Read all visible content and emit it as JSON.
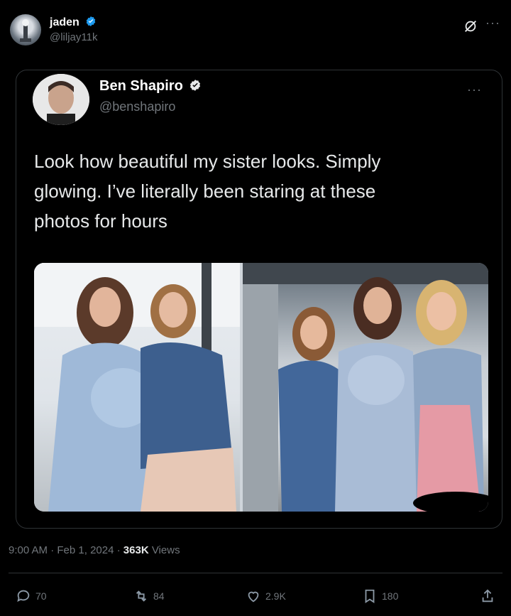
{
  "outer_tweet": {
    "name": "jaden",
    "handle": "@liljay11k"
  },
  "quoted_tweet": {
    "name": "Ben Shapiro",
    "handle": "@benshapiro",
    "text_lines": [
      "Look how beautiful my sister looks. Simply",
      "glowing. I’ve literally been staring at these",
      "photos for hours"
    ]
  },
  "meta": {
    "time": "9:00 AM",
    "date": "Feb 1, 2024",
    "views_count": "363K",
    "views_label": "Views"
  },
  "actions": {
    "replies": "70",
    "reposts": "84",
    "likes": "2.9K",
    "bookmarks": "180"
  },
  "colors": {
    "background": "#000000",
    "verified": "#1d9bf0",
    "muted": "#71767b"
  }
}
